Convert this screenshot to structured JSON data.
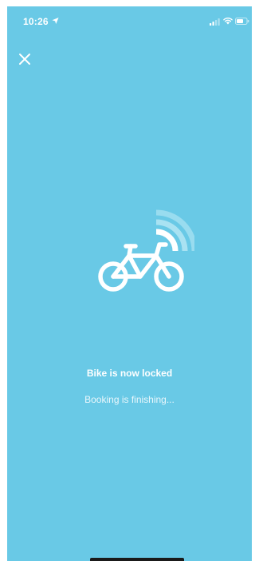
{
  "status_bar": {
    "time": "10:26",
    "location_icon": "location-arrow-icon",
    "signal_icon": "cellular-signal-icon",
    "wifi_icon": "wifi-icon",
    "battery_icon": "battery-icon"
  },
  "header": {
    "close_icon": "close-icon"
  },
  "illustration": {
    "bike_icon": "bicycle-icon",
    "signal_waves_icon": "wireless-signal-icon"
  },
  "status": {
    "title": "Bike is now locked",
    "subtitle": "Booking is finishing..."
  },
  "colors": {
    "background": "#69c9e6",
    "foreground": "#ffffff",
    "signal_waves": "#a9e2f2"
  }
}
